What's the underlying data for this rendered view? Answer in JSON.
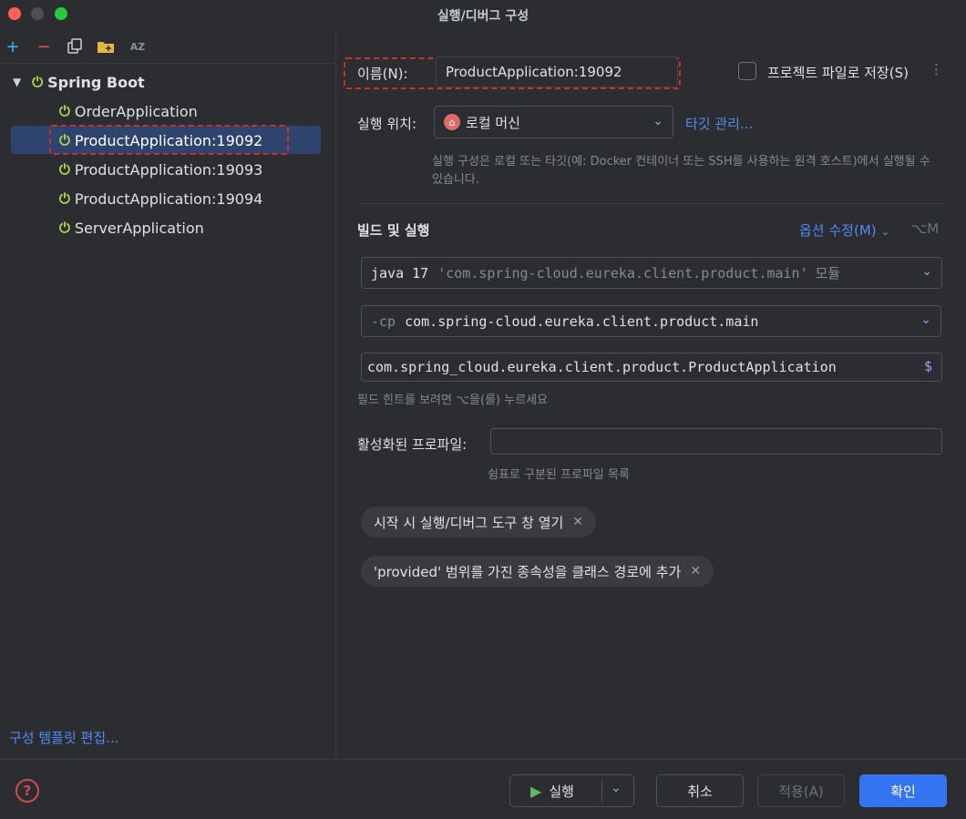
{
  "window": {
    "title": "실행/디버그 구성"
  },
  "left_toolbar": {
    "add_icon": "plus-icon",
    "remove_icon": "minus-icon",
    "copy_icon": "copy-icon",
    "folder_icon": "new-folder-icon",
    "sort_icon": "sort-az-icon",
    "add_glyph": "+",
    "remove_glyph": "−",
    "sort_glyph": "AZ"
  },
  "tree": {
    "group_label": "Spring Boot",
    "items": [
      {
        "label": "OrderApplication"
      },
      {
        "label": "ProductApplication:19092",
        "selected": true
      },
      {
        "label": "ProductApplication:19093"
      },
      {
        "label": "ProductApplication:19094"
      },
      {
        "label": "ServerApplication"
      }
    ]
  },
  "edit_templates_link": "구성 템플릿 편집...",
  "form": {
    "name_label": "이름(N):",
    "name_value": "ProductApplication:19092",
    "save_to_project_label": "프로젝트 파일로 저장(S)",
    "run_on_label": "실행 위치:",
    "run_on_value": "로컬 머신",
    "manage_targets_link": "타깃 관리...",
    "run_on_hint": "실행 구성은 로컬 또는 타깃(예: Docker 컨테이너 또는 SSH를 사용하는 원격 호스트)에서 실행될 수 있습니다.",
    "build_run_section": "빌드 및 실행",
    "modify_options_link": "옵션 수정(M)",
    "modify_options_shortcut": "⌥M",
    "jre_prefix": "java 17",
    "jre_module": "'com.spring-cloud.eureka.client.product.main'",
    "jre_suffix": "모듈",
    "cp_prefix": "-cp",
    "cp_value": "com.spring-cloud.eureka.client.product.main",
    "main_class": "com.spring_cloud.eureka.client.product.ProductApplication",
    "main_class_macro": "$",
    "field_hint": "필드 힌트를 보려면 ⌥을(를) 누르세요",
    "profiles_label": "활성화된 프로파일:",
    "profiles_value": "",
    "profiles_hint": "쉼표로 구분된 프로파일 목록",
    "chips": [
      {
        "label": "시작 시 실행/디버그 도구 창 열기"
      },
      {
        "label": "'provided' 범위를 가진 종속성을 클래스 경로에 추가"
      }
    ]
  },
  "footer": {
    "run_label": "실행",
    "cancel_label": "취소",
    "apply_label": "적용(A)",
    "ok_label": "확인",
    "help_glyph": "?"
  },
  "colors": {
    "accent": "#548af7",
    "selection": "#2e436e",
    "highlight_dash": "#c8312d",
    "spring_icon": "#b8d84a",
    "ok_button": "#3574f0"
  }
}
